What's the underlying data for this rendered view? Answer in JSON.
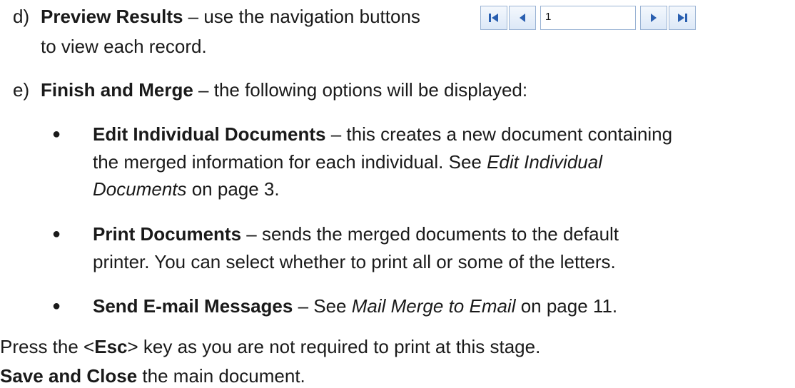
{
  "items": {
    "d": {
      "marker": "d)",
      "title": "Preview Results",
      "desc1": " – use the navigation buttons ",
      "desc2": "to view each record."
    },
    "e": {
      "marker": "e)",
      "title": "Finish and Merge",
      "desc": " – the following options will be displayed:"
    }
  },
  "navigation": {
    "record_value": "1",
    "icons": [
      "first-record-icon",
      "previous-record-icon",
      "next-record-icon",
      "last-record-icon"
    ],
    "accent": "#2a5fb0",
    "border": "#9ab3d4"
  },
  "bullets": [
    {
      "title": "Edit Individual Documents",
      "text1": " – this creates a new document containing",
      "text2": "the merged information for each individual.  See ",
      "ref1": "Edit Individual",
      "ref2": "Documents",
      "text3": " on page 3."
    },
    {
      "title": "Print Documents",
      "text1": " – sends the merged documents to the default",
      "text2": "printer.  You can select whether to print all or some of the letters."
    },
    {
      "title": "Send E-mail Messages",
      "text1": " – See ",
      "ref": "Mail Merge to Email",
      "text2": " on page 11."
    }
  ],
  "footer": {
    "press_pre": "Press the <",
    "press_key": "Esc",
    "press_post": "> key as you are not required to print at this stage.",
    "save_bold": "Save and Close",
    "save_rest": " the main document."
  }
}
